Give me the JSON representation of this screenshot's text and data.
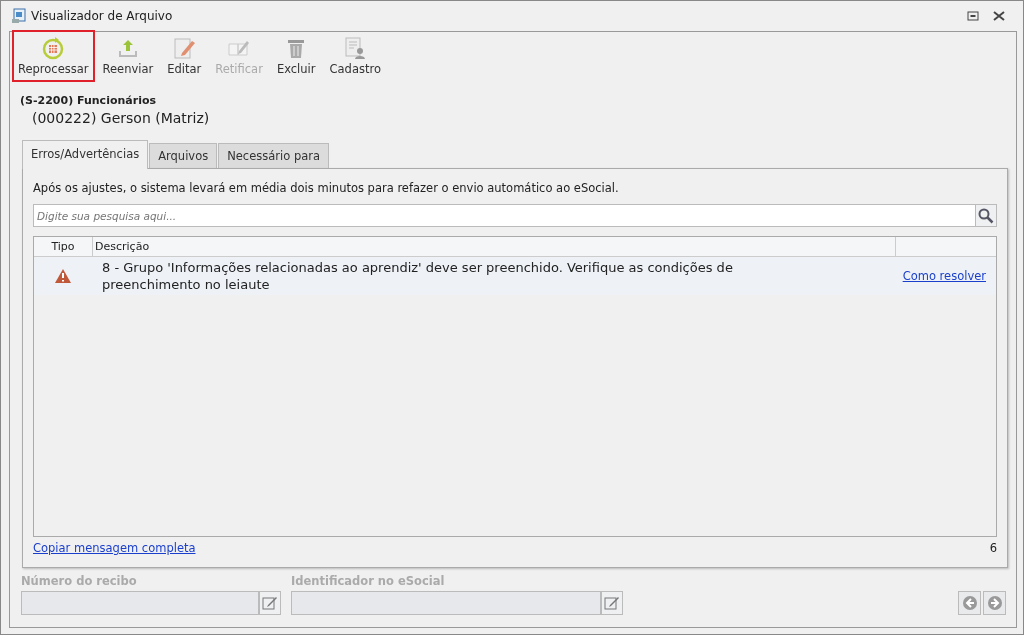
{
  "window": {
    "title": "Visualizador de Arquivo"
  },
  "toolbar": [
    {
      "label": "Reprocessar",
      "kind": "reprocess",
      "disabled": false,
      "highlighted": true
    },
    {
      "label": "Reenviar",
      "kind": "upload",
      "disabled": false,
      "highlighted": false
    },
    {
      "label": "Editar",
      "kind": "edit",
      "disabled": false,
      "highlighted": false
    },
    {
      "label": "Retificar",
      "kind": "rectify",
      "disabled": true,
      "highlighted": false
    },
    {
      "label": "Excluir",
      "kind": "delete",
      "disabled": false,
      "highlighted": false
    },
    {
      "label": "Cadastro",
      "kind": "register",
      "disabled": false,
      "highlighted": false
    }
  ],
  "event": {
    "title": "(S-2200) Funcionários",
    "subtitle": "(000222) Gerson (Matriz)"
  },
  "tabs": [
    {
      "label": "Erros/Advertências",
      "selected": true
    },
    {
      "label": "Arquivos",
      "selected": false
    },
    {
      "label": "Necessário para",
      "selected": false
    }
  ],
  "notice": "Após os ajustes, o sistema levará em média dois minutos para refazer o envio automático ao eSocial.",
  "search": {
    "placeholder": "Digite sua pesquisa aqui..."
  },
  "table": {
    "columns": [
      "Tipo",
      "Descrição"
    ],
    "rows": [
      {
        "kind": "warning",
        "description": "8  - Grupo 'Informações relacionadas ao aprendiz' deve ser preenchido. Verifique as condições de preenchimento no leiaute",
        "link": "Como resolver"
      }
    ]
  },
  "copy_link": "Copiar mensagem completa",
  "count": "6",
  "fields": [
    {
      "label": "Número do recibo",
      "disabled": true
    },
    {
      "label": "Identificador no eSocial",
      "disabled": true
    }
  ]
}
